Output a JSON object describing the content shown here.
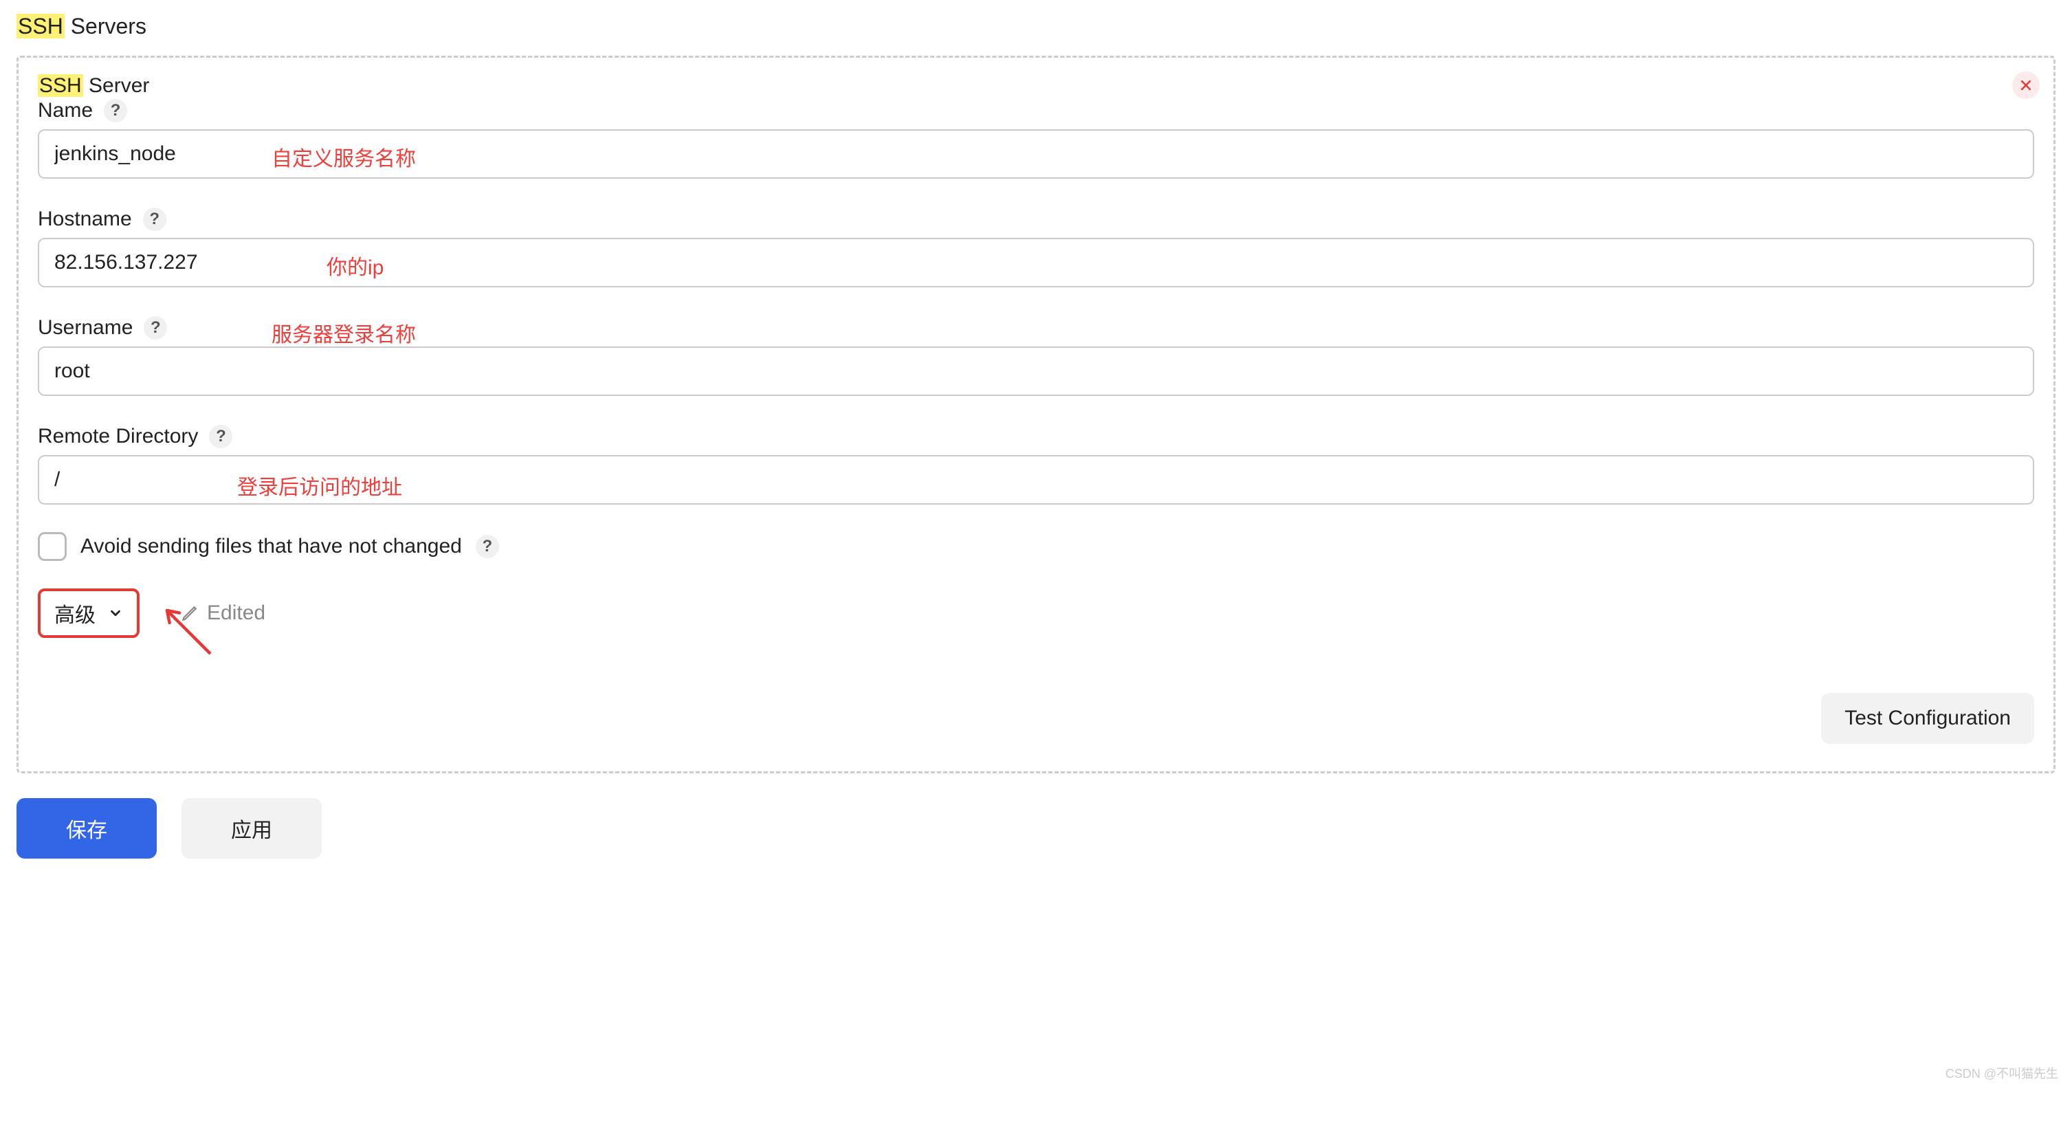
{
  "section": {
    "title_hl": "SSH",
    "title_rest": " Servers"
  },
  "panel": {
    "title_hl": "SSH",
    "title_rest": " Server",
    "close_icon": "×"
  },
  "fields": {
    "name": {
      "label": "Name",
      "help": "?",
      "value": "jenkins_node",
      "annotation": "自定义服务名称"
    },
    "hostname": {
      "label": "Hostname",
      "help": "?",
      "value": "82.156.137.227",
      "annotation": "你的ip"
    },
    "username": {
      "label": "Username",
      "help": "?",
      "value": "root",
      "annotation": "服务器登录名称"
    },
    "remote_dir": {
      "label": "Remote Directory",
      "help": "?",
      "value": "/",
      "annotation": "登录后访问的地址"
    }
  },
  "checkbox": {
    "label": "Avoid sending files that have not changed",
    "help": "?"
  },
  "advanced": {
    "label": "高级"
  },
  "edited": {
    "label": "Edited"
  },
  "test_button": "Test Configuration",
  "footer": {
    "save": "保存",
    "apply": "应用"
  },
  "watermark": "CSDN @不叫猫先生"
}
